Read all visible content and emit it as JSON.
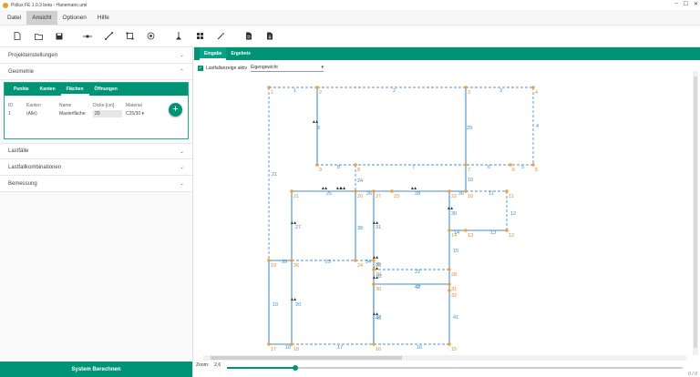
{
  "window": {
    "title": "Pollux FE 1.0.3 beta - Hanemann.uml"
  },
  "menu": [
    "Datei",
    "Ansicht",
    "Optionen",
    "Hilfe"
  ],
  "menu_active": 1,
  "toolbar_icons": [
    "new-file-icon",
    "open-folder-icon",
    "save-icon",
    "node-icon",
    "line-icon",
    "area-icon",
    "target-icon",
    "support-icon",
    "grid-icon",
    "magic-wand-icon",
    "report-icon",
    "export-icon"
  ],
  "sidebar": {
    "sections": {
      "projekt": "Projekteinstellungen",
      "geometrie": "Geometrie",
      "lastfaelle": "Lastfälle",
      "lastfallkombinationen": "Lastfallkombinationen",
      "bemessung": "Bemessung"
    },
    "geo_tabs": [
      "Punkte",
      "Kanten",
      "Flächen",
      "Öffnungen"
    ],
    "geo_tab_active": 2,
    "table": {
      "headers": [
        "ID",
        "Kanten",
        "Name",
        "Dicke [cm]",
        "Material"
      ],
      "row": {
        "id": "1",
        "kanten": "(Alle)",
        "name": "Masterfläche",
        "dicke": "20",
        "material": "C25/30"
      }
    },
    "calc_button": "System Berechnen"
  },
  "main": {
    "tabs": [
      "Eingabe",
      "Ergebnis"
    ],
    "tab_active": 0,
    "lastfall_label": "Lastfallanzeige aktiv",
    "lastfall_value": "Eigengewicht",
    "zoom_label": "Zoom:",
    "zoom_value": "2,6",
    "zoom_fraction": 0.15,
    "corner_text": "0 / 0"
  },
  "model": {
    "point_labels": [
      "1",
      "2",
      "3",
      "4",
      "5",
      "6",
      "7",
      "8",
      "9",
      "10",
      "11",
      "12",
      "13",
      "14",
      "15",
      "16",
      "17",
      "18",
      "19",
      "20",
      "21",
      "22",
      "23",
      "24",
      "25",
      "26",
      "27",
      "28",
      "29",
      "30",
      "31",
      "32"
    ],
    "edge_labels": [
      "1",
      "2",
      "3",
      "4",
      "5",
      "6",
      "7",
      "8",
      "9",
      "10",
      "11",
      "12",
      "13",
      "14",
      "15",
      "16",
      "17",
      "18",
      "19",
      "20",
      "21",
      "22",
      "23",
      "24",
      "25",
      "26",
      "27",
      "28",
      "29",
      "30",
      "31",
      "32",
      "33",
      "34",
      "35",
      "36",
      "37",
      "38",
      "39",
      "40",
      "41",
      "42"
    ]
  }
}
